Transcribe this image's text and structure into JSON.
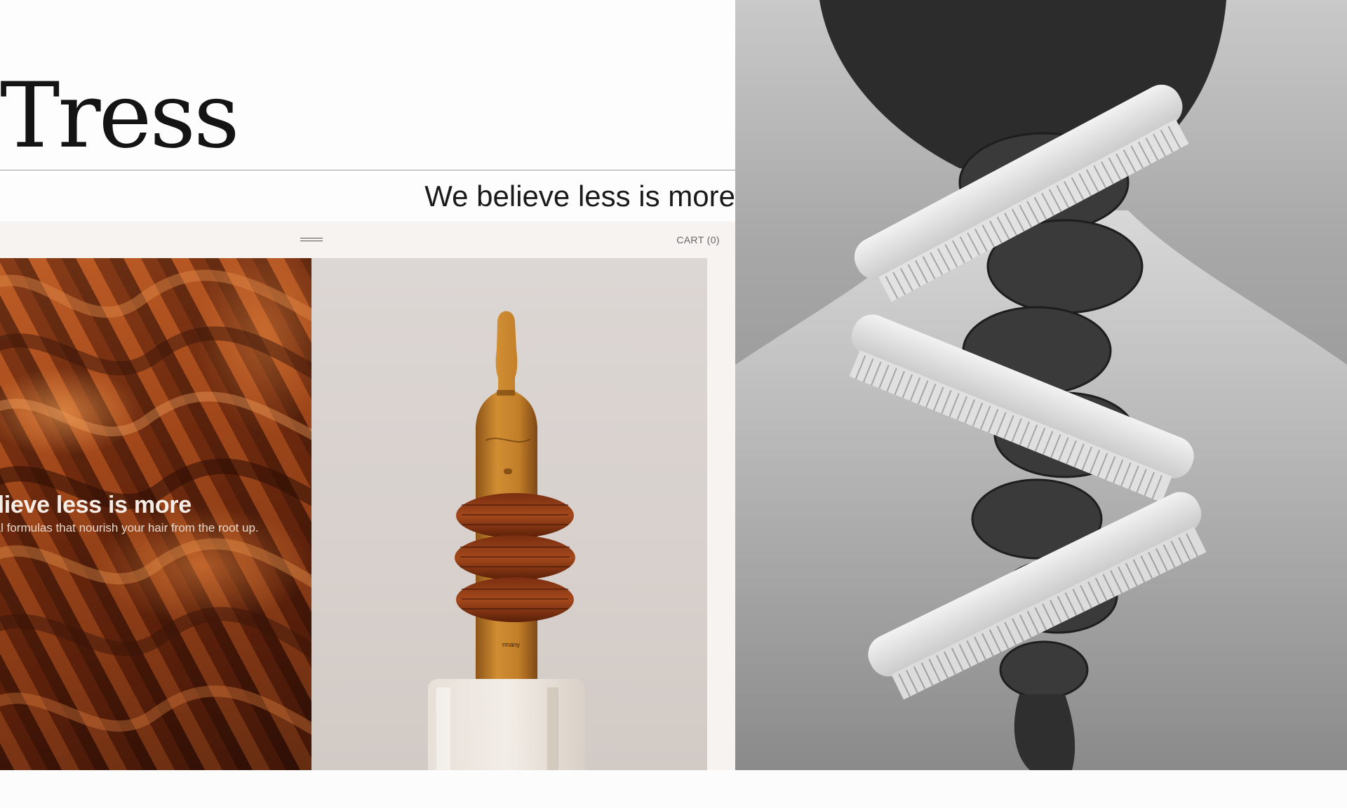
{
  "brand": {
    "name": "Tress"
  },
  "tagline": "We believe less is more",
  "nav": {
    "cart_label": "CART (0)"
  },
  "hero": {
    "headline": "elieve less is more",
    "subtext": "ral formulas that nourish your hair from the root up."
  },
  "product": {
    "label_text": "rmany"
  },
  "colors": {
    "page_background": "#fdfcfd",
    "nav_background": "#f7f3f1",
    "text_dark": "#141414",
    "hair_copper": "#a4481c",
    "amber": "#b8731c"
  },
  "icons": [
    "menu-icon"
  ]
}
